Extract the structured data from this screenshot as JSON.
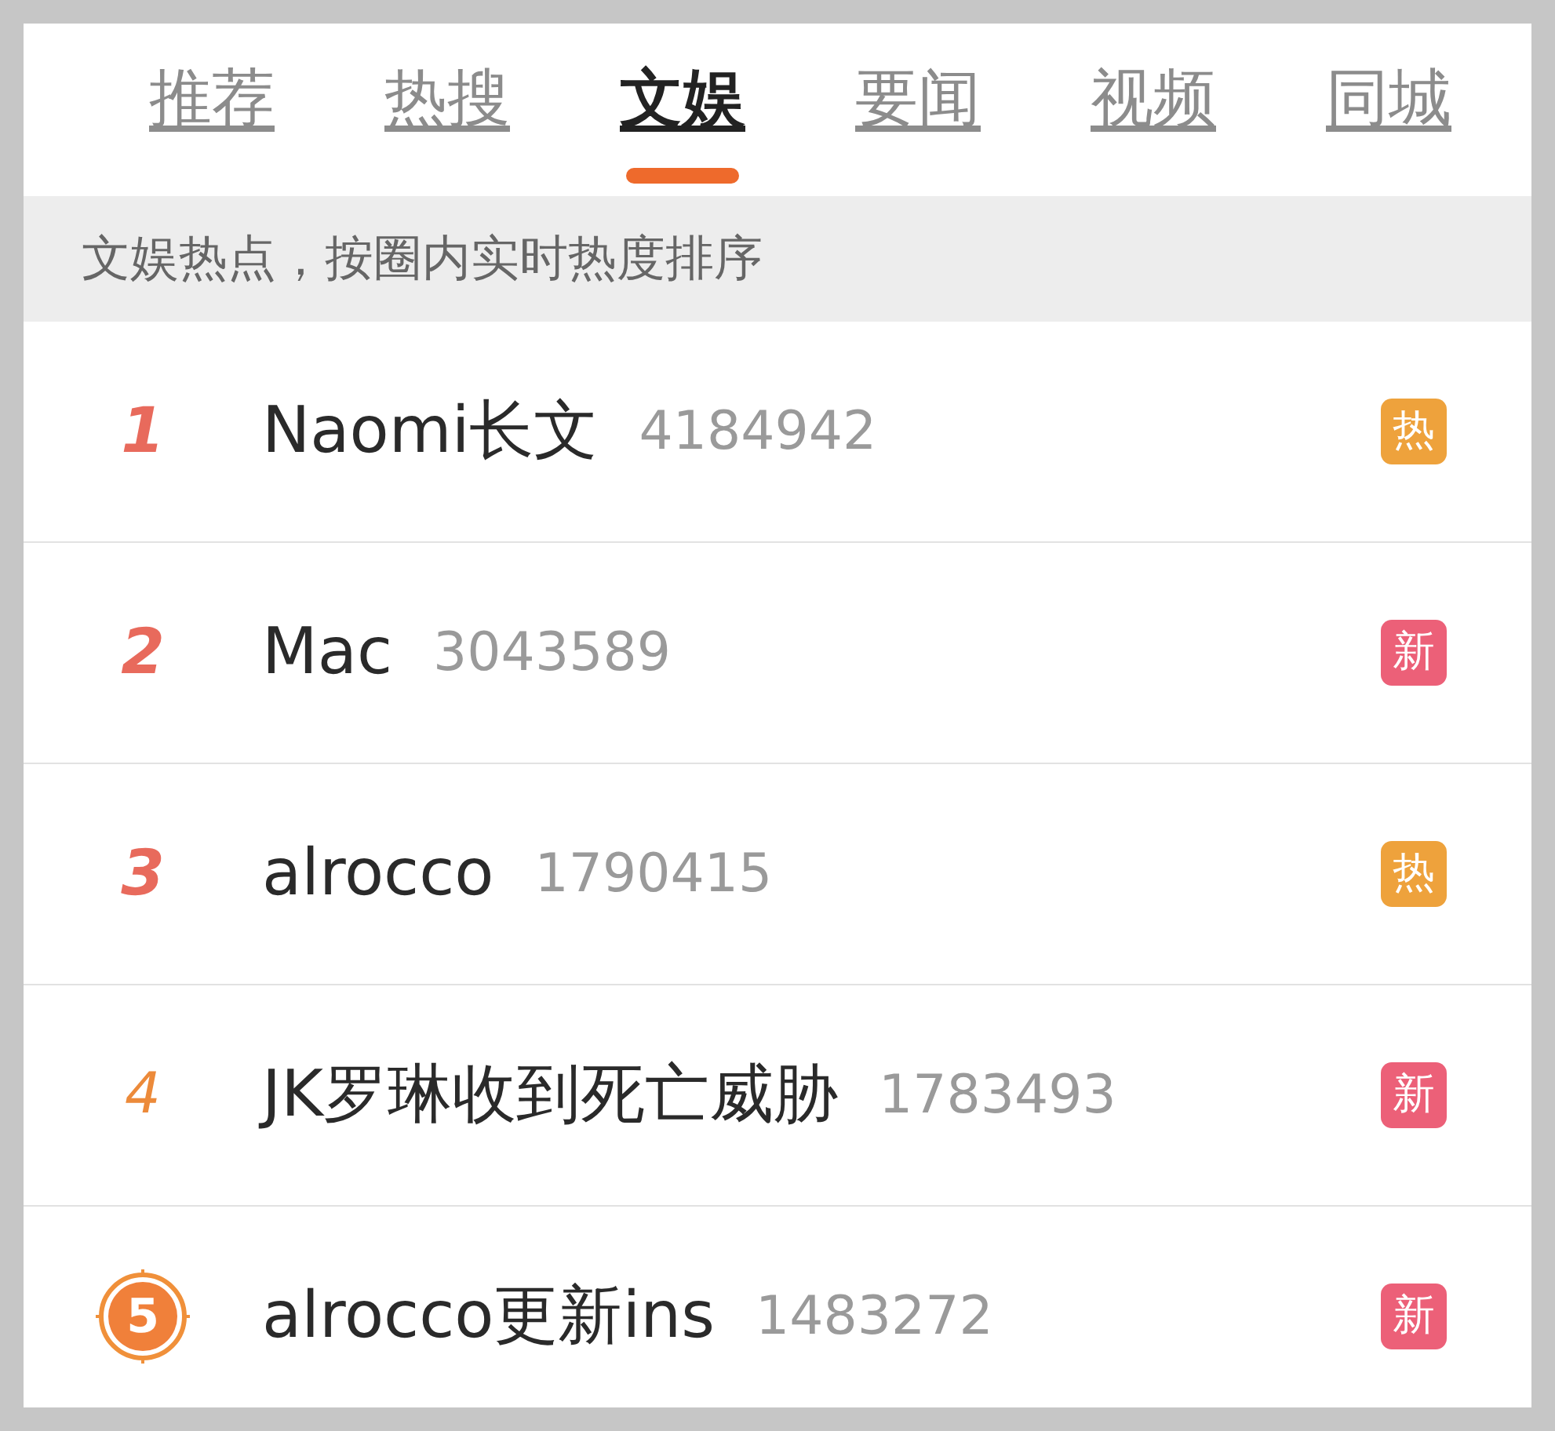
{
  "tabs": [
    {
      "label": "推荐",
      "selected": false
    },
    {
      "label": "热搜",
      "selected": false
    },
    {
      "label": "文娱",
      "selected": true
    },
    {
      "label": "要闻",
      "selected": false
    },
    {
      "label": "视频",
      "selected": false
    },
    {
      "label": "同城",
      "selected": false
    }
  ],
  "subtitle": "文娱热点，按圈内实时热度排序",
  "rows": [
    {
      "rank": {
        "text": "1",
        "kind": "top"
      },
      "title": "Naomi长文",
      "count": "4184942",
      "badge": {
        "text": "热",
        "kind": "hot"
      }
    },
    {
      "rank": {
        "text": "2",
        "kind": "top"
      },
      "title": "Mac",
      "count": "3043589",
      "badge": {
        "text": "新",
        "kind": "new"
      }
    },
    {
      "rank": {
        "text": "3",
        "kind": "top"
      },
      "title": "alrocco",
      "count": "1790415",
      "badge": {
        "text": "热",
        "kind": "hot"
      }
    },
    {
      "rank": {
        "text": "4",
        "kind": "plain"
      },
      "title": "JK罗琳收到死亡威胁",
      "count": "1783493",
      "badge": {
        "text": "新",
        "kind": "new"
      }
    },
    {
      "rank": {
        "text": "5",
        "kind": "circle"
      },
      "title": "alrocco更新ins",
      "count": "1483272",
      "badge": {
        "text": "新",
        "kind": "new"
      }
    }
  ]
}
